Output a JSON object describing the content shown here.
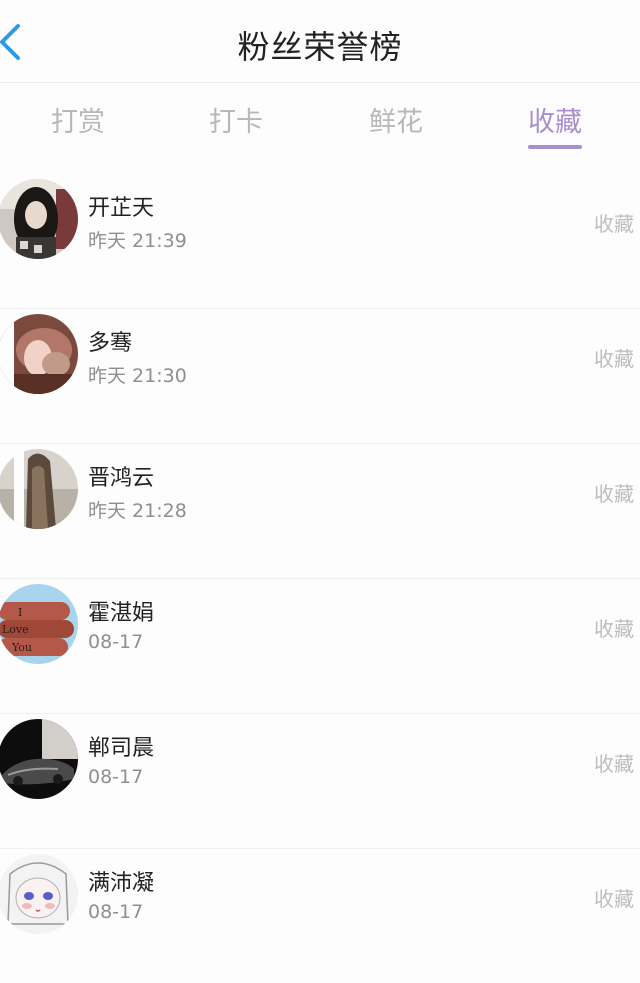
{
  "header": {
    "title": "粉丝荣誉榜"
  },
  "tabs": [
    {
      "label": "打赏"
    },
    {
      "label": "打卡"
    },
    {
      "label": "鲜花"
    },
    {
      "label": "收藏"
    }
  ],
  "active_tab": "收藏",
  "fans": [
    {
      "name": "开芷天",
      "time": "昨天 21:39",
      "action": "收藏"
    },
    {
      "name": "多骞",
      "time": "昨天 21:30",
      "action": "收藏"
    },
    {
      "name": "晋鸿云",
      "time": "昨天 21:28",
      "action": "收藏"
    },
    {
      "name": "霍湛娟",
      "time": "08-17",
      "action": "收藏",
      "avatar_text": [
        "I",
        "Love",
        "You"
      ]
    },
    {
      "name": "郸司晨",
      "time": "08-17",
      "action": "收藏"
    },
    {
      "name": "满沛凝",
      "time": "08-17",
      "action": "收藏"
    }
  ],
  "colors": {
    "accent": "#a88fd1",
    "back_icon": "#2c9be6"
  }
}
